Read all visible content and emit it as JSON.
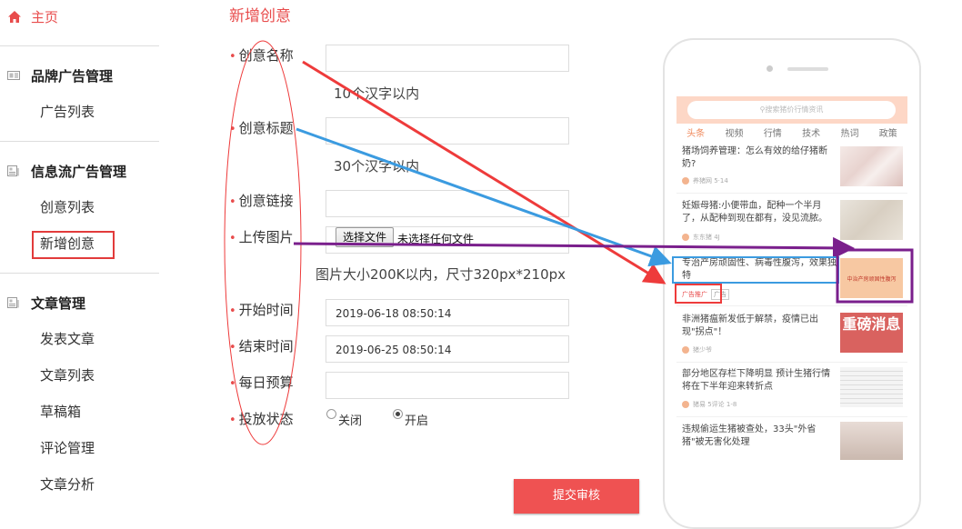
{
  "sidebar": {
    "home_label": "主页",
    "groups": [
      {
        "title": "品牌广告管理",
        "items": [
          "广告列表"
        ]
      },
      {
        "title": "信息流广告管理",
        "items": [
          "创意列表",
          "新增创意"
        ]
      },
      {
        "title": "文章管理",
        "items": [
          "发表文章",
          "文章列表",
          "草稿箱",
          "评论管理",
          "文章分析"
        ]
      }
    ],
    "active_item": "新增创意"
  },
  "form": {
    "title": "新增创意",
    "fields": {
      "name_label": "创意名称",
      "name_value": "",
      "name_hint": "10个汉字以内",
      "headline_label": "创意标题",
      "headline_value": "",
      "headline_hint": "30个汉字以内",
      "link_label": "创意链接",
      "link_value": "",
      "image_label": "上传图片",
      "file_button": "选择文件",
      "file_status": "未选择任何文件",
      "image_hint": "图片大小200K以内，尺寸320px*210px",
      "start_label": "开始时间",
      "start_value": "2019-06-18 08:50:14",
      "end_label": "结束时间",
      "end_value": "2019-06-25 08:50:14",
      "budget_label": "每日预算",
      "budget_value": "",
      "status_label": "投放状态",
      "status_off": "关闭",
      "status_on": "开启",
      "status_selected": "开启"
    },
    "submit_label": "提交审核"
  },
  "phone_preview": {
    "search_placeholder": "搜索猪价行情资讯",
    "tabs": [
      "头条",
      "视频",
      "行情",
      "技术",
      "热词",
      "政策"
    ],
    "active_tab": "头条",
    "news": [
      {
        "title": "猪场饲养管理：怎么有效的给仔猪断奶?",
        "source": "养猪网 5·14"
      },
      {
        "title": "妊娠母猪:小便带血，配种一个半月了，从配种到现在都有，没见流脓。",
        "source": "东东猪 4J"
      },
      {
        "title": "专治产房顽固性、病毒性腹泻，效果独特",
        "source": "广告推广",
        "ad_thumb_text": "中治产房顽固性腹泻"
      },
      {
        "title": "非洲猪瘟新发低于解禁，疫情已出现\"拐点\"！",
        "source": "猪少爷"
      },
      {
        "title": "部分地区存栏下降明显 预计生猪行情将在下半年迎来转折点",
        "source": "猪易 5评论 1-8"
      },
      {
        "title": "违规偷运生猪被查处，33头\"外省猪\"被无害化处理",
        "source": ""
      }
    ],
    "news4_thumb_text": "重磅消息"
  },
  "colors": {
    "accent": "#e84c4c",
    "submit": "#ef5252",
    "arrow_red": "#ee3b3b",
    "arrow_blue": "#3b9be0",
    "arrow_purple": "#7a1f8c"
  }
}
